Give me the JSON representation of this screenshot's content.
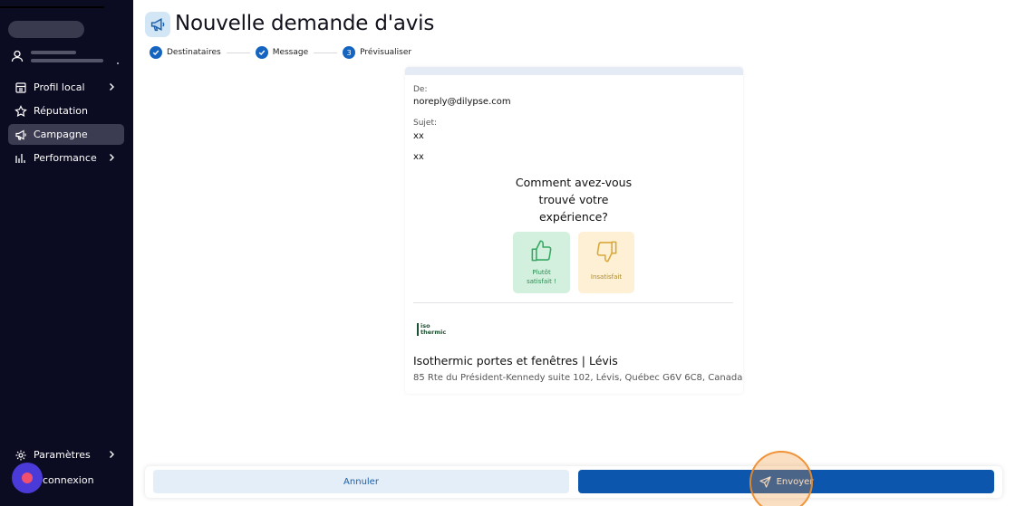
{
  "sidebar": {
    "nav": [
      {
        "label": "Profil local",
        "icon": "building-icon",
        "has_submenu": true
      },
      {
        "label": "Réputation",
        "icon": "star-icon",
        "has_submenu": false
      },
      {
        "label": "Campagne",
        "icon": "megaphone-icon",
        "has_submenu": false,
        "active": true
      },
      {
        "label": "Performance",
        "icon": "bar-chart-icon",
        "has_submenu": true
      }
    ],
    "settings_label": "Paramètres",
    "logout_label": "connexion"
  },
  "header": {
    "title": "Nouvelle demande d'avis",
    "steps": [
      {
        "label": "Destinataires",
        "state": "done"
      },
      {
        "label": "Message",
        "state": "done"
      },
      {
        "number": "3",
        "label": "Prévisualiser",
        "state": "current"
      }
    ]
  },
  "preview": {
    "from_label": "De:",
    "from_value": "noreply@dilypse.com",
    "subject_label": "Sujet:",
    "subject_value": "xx",
    "body": "xx",
    "question_lines": [
      "Comment avez-vous",
      "trouvé votre",
      "expérience?"
    ],
    "satisfied_lines": [
      "Plutôt",
      "satisfait !"
    ],
    "unsatisfied_label": "Insatisfait",
    "logo_lines": [
      "iso",
      "thermic"
    ],
    "business_name": "Isothermic portes et fenêtres | Lévis",
    "business_address": "85 Rte du Président-Kennedy suite 102, Lévis, Québec G6V 6C8, Canada"
  },
  "footer": {
    "cancel_label": "Annuler",
    "send_label": "Envoyer"
  },
  "colors": {
    "sidebar_bg": "#0b0b22",
    "primary": "#0c57ad",
    "satisfied_bg": "#d3f0de",
    "unsatisfied_bg": "#fdf0d4"
  }
}
